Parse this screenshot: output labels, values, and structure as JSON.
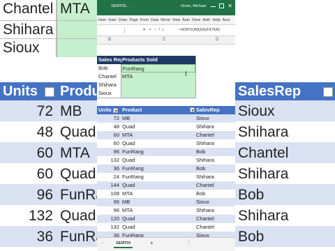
{
  "window": {
    "filename": "SEMT05...",
    "user": "Girvin, Michael"
  },
  "ribbon": {
    "tabs": [
      "Hom",
      "Inser",
      "Draw",
      "Page",
      "Form",
      "Data",
      "Revie",
      "View",
      "Auto",
      "Deve",
      "Add-",
      "Help",
      "Acro"
    ]
  },
  "formula_bar": {
    "name_box": "",
    "text": "=SORT(UNIQUE(FILTER("
  },
  "columns": [
    "B",
    "C",
    "D"
  ],
  "lookup": {
    "header_left": "Sales Rep",
    "header_right": "Products Sold",
    "rows": [
      {
        "rep": "Bob",
        "products": "FunRang"
      },
      {
        "rep": "Chantel",
        "products": "MTA"
      },
      {
        "rep": "Shihara",
        "products": ""
      },
      {
        "rep": "Sioux",
        "products": ""
      }
    ]
  },
  "table": {
    "headers": [
      "Units",
      "Product",
      "SalesRep"
    ],
    "rows": [
      [
        "72",
        "MB",
        "Sioux"
      ],
      [
        "48",
        "Quad",
        "Shihara"
      ],
      [
        "60",
        "MTA",
        "Chantel"
      ],
      [
        "60",
        "Quad",
        "Shihara"
      ],
      [
        "96",
        "FunRang",
        "Bob"
      ],
      [
        "132",
        "Quad",
        "Shihara"
      ],
      [
        "36",
        "FunRang",
        "Bob"
      ],
      [
        "24",
        "FunRang",
        "Shihara"
      ],
      [
        "144",
        "Quad",
        "Chantel"
      ],
      [
        "108",
        "MTA",
        "Bob"
      ],
      [
        "96",
        "MB",
        "Sioux"
      ],
      [
        "96",
        "MTA",
        "Shihara"
      ],
      [
        "120",
        "Quad",
        "Chantel"
      ],
      [
        "132",
        "Quad",
        "Chantel"
      ],
      [
        "36",
        "FunRang",
        "Sioux"
      ]
    ]
  },
  "sheet_tab": "SEMT05",
  "background": {
    "top_names": [
      "Chantel",
      "Shihara",
      "Sioux"
    ],
    "top_product": "MTA",
    "left_headers": [
      "Units",
      "Product"
    ],
    "right_header": "SalesRep",
    "left_rows": [
      [
        "72",
        "MB"
      ],
      [
        "48",
        "Quad"
      ],
      [
        "60",
        "MTA"
      ],
      [
        "60",
        "Quad"
      ],
      [
        "96",
        "FunRang"
      ],
      [
        "132",
        "Quad"
      ],
      [
        "36",
        "FunRang"
      ]
    ],
    "right_rows": [
      "Sioux",
      "Shihara",
      "Chantel",
      "Shihara",
      "Bob",
      "Shihara",
      "Bob"
    ]
  }
}
